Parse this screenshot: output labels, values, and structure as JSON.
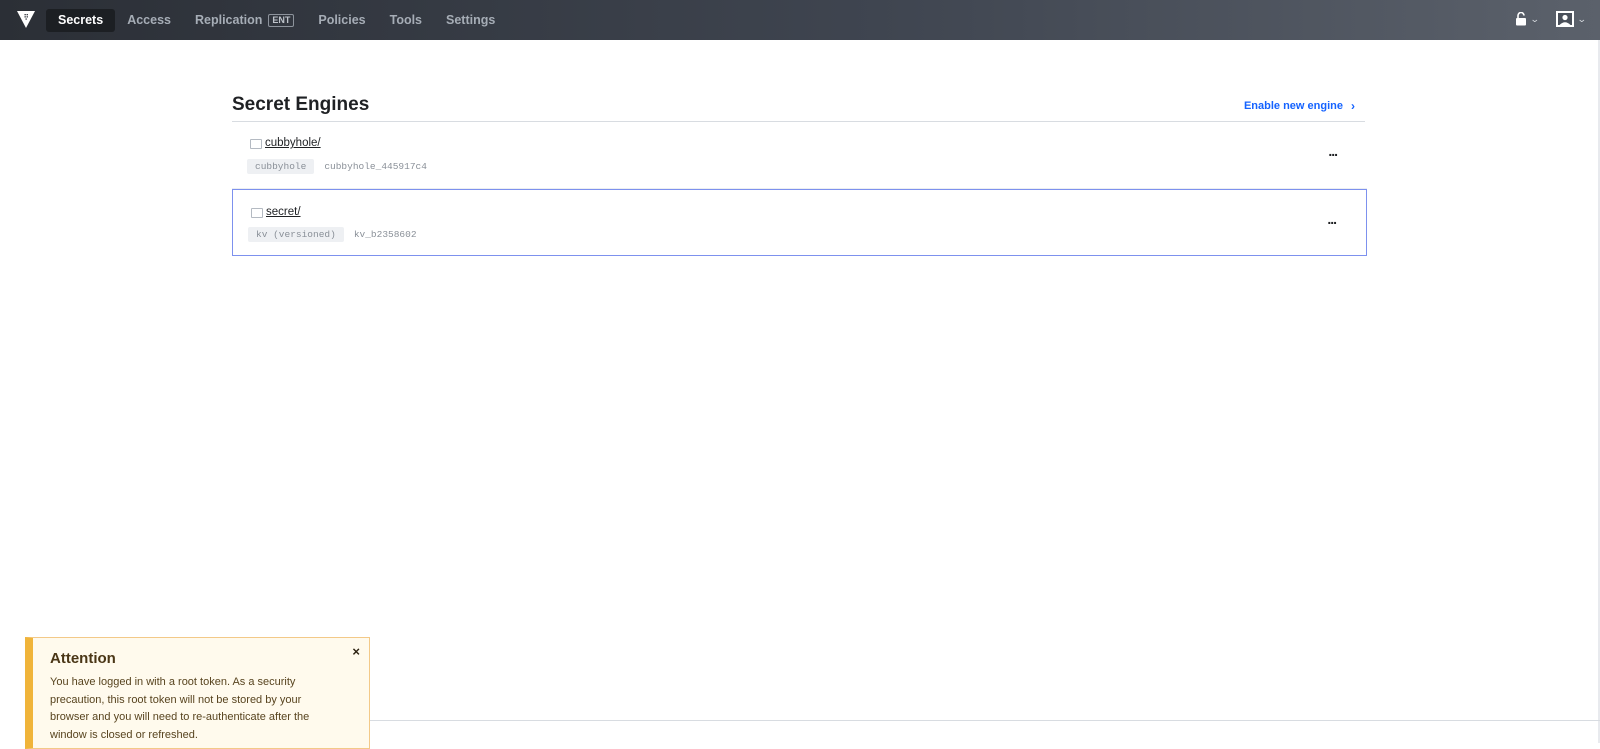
{
  "nav": {
    "items": [
      {
        "label": "Secrets",
        "active": true
      },
      {
        "label": "Access"
      },
      {
        "label": "Replication",
        "badge": "ENT"
      },
      {
        "label": "Policies"
      },
      {
        "label": "Tools"
      },
      {
        "label": "Settings"
      }
    ],
    "icons": {
      "logo": "vault-logo-icon",
      "status": "unlock-icon",
      "user": "user-icon"
    }
  },
  "page": {
    "title": "Secret Engines",
    "enable_link": "Enable new engine",
    "enable_arrow": "›"
  },
  "engines": [
    {
      "name": "cubbyhole/",
      "type": "cubbyhole",
      "accessor": "cubbyhole_445917c4",
      "menu": "..."
    },
    {
      "name": "secret/",
      "type": "kv (versioned)",
      "accessor": "kv_b2358602",
      "menu": "..."
    }
  ],
  "toast": {
    "title": "Attention",
    "close": "×",
    "message": "You have logged in with a root token. As a security precaution, this root token will not be stored by your browser and you will need to re-authenticate after the window is closed or refreshed."
  },
  "colors": {
    "accent": "#1563ff",
    "selected_border": "#7d91ee",
    "warning": "#f0b43a"
  }
}
